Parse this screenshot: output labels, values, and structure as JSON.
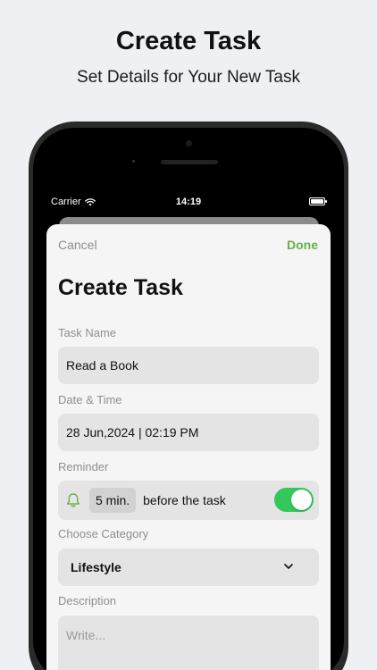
{
  "promo": {
    "title": "Create Task",
    "subtitle": "Set Details for Your New Task"
  },
  "status_bar": {
    "carrier": "Carrier",
    "time": "14:19"
  },
  "sheet": {
    "cancel_label": "Cancel",
    "done_label": "Done",
    "title": "Create Task",
    "task_name": {
      "label": "Task Name",
      "value": "Read a Book"
    },
    "date_time": {
      "label": "Date & Time",
      "value": "28 Jun,2024 | 02:19 PM"
    },
    "reminder": {
      "label": "Reminder",
      "amount": "5 min.",
      "suffix": "before the task",
      "enabled": true
    },
    "category": {
      "label": "Choose Category",
      "selected": "Lifestyle"
    },
    "description": {
      "label": "Description",
      "placeholder": "Write..."
    }
  },
  "colors": {
    "accent_green": "#6ab04c",
    "toggle_on": "#34c759",
    "background": "#eef0f3"
  },
  "icons": {
    "reminder": "bell-icon",
    "category": "chevron-down-icon",
    "wifi": "wifi-icon",
    "battery": "battery-icon"
  }
}
